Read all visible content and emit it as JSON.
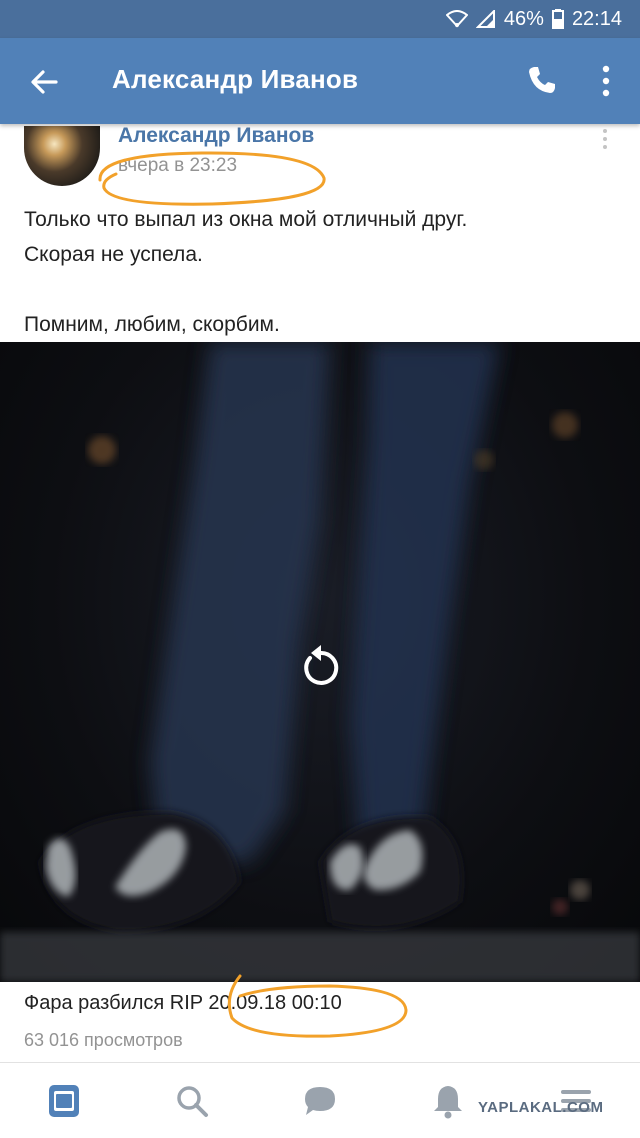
{
  "status_bar": {
    "battery": "46%",
    "time": "22:14"
  },
  "header": {
    "title": "Александр Иванов"
  },
  "post": {
    "author": "Александр Иванов",
    "timestamp": "вчера в 23:23",
    "text_lines": [
      "Только что выпал из окна мой отличный друг.",
      "Скорая не успела.",
      "",
      "Помним, любим, скорбим."
    ]
  },
  "video": {
    "caption_title": "Фара разбился RIP",
    "caption_date": "20.09.18 00:10",
    "views": "63 016 просмотров"
  },
  "tabs": [
    {
      "name": "news",
      "icon": "newspaper-icon"
    },
    {
      "name": "search",
      "icon": "search-icon"
    },
    {
      "name": "messages",
      "icon": "chat-bubble-icon"
    },
    {
      "name": "notifications",
      "icon": "bell-icon"
    },
    {
      "name": "menu",
      "icon": "menu-icon"
    }
  ],
  "watermark": "YAPLAKAL.COM",
  "colors": {
    "header": "#5181b8",
    "status_bar": "#4a6f9c",
    "link": "#4a76a8",
    "annotation": "#f2a12a"
  }
}
